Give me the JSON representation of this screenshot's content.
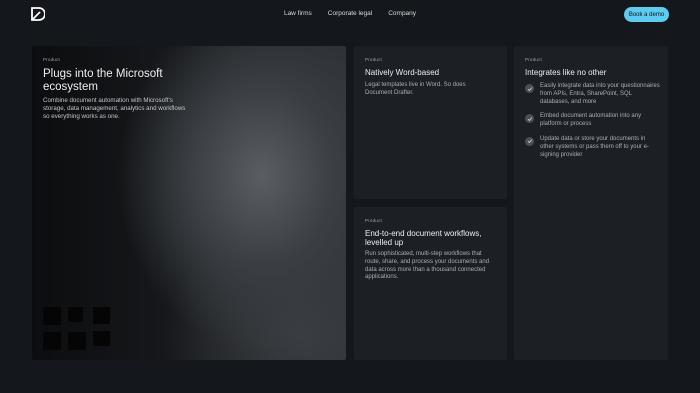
{
  "nav": {
    "links": [
      "Law firms",
      "Corporate legal",
      "Company"
    ],
    "cta_label": "Book a demo"
  },
  "cards": {
    "microsoft": {
      "label": "Product",
      "title": "Plugs into the Microsoft ecosystem",
      "body": "Combine document automation with Microsoft's storage, data management, analytics and workflows so everything works as one."
    },
    "word": {
      "label": "Product",
      "title": "Natively Word-based",
      "body": "Legal templates live in Word. So does Document Drafter."
    },
    "workflows": {
      "label": "Product",
      "title": "End-to-end document workflows, levelled up",
      "body": "Run sophisticated, multi-step workflows that route, share, and process your documents and data across more than a thousand connected applications."
    },
    "integrates": {
      "label": "Product",
      "title": "Integrates like no other",
      "items": [
        "Easily integrate data into your questionnaires from APIs, Entra, SharePoint, SQL databases, and more",
        "Embed document automation into any platform or process",
        "Update data or store your documents in other systems or pass them off to your e-signing provider"
      ]
    }
  },
  "colors": {
    "accent": "#5ecbf0",
    "background": "#14171b",
    "card": "#1c2025"
  },
  "icons": {
    "logo": "logo-icon",
    "check": "check-icon"
  }
}
